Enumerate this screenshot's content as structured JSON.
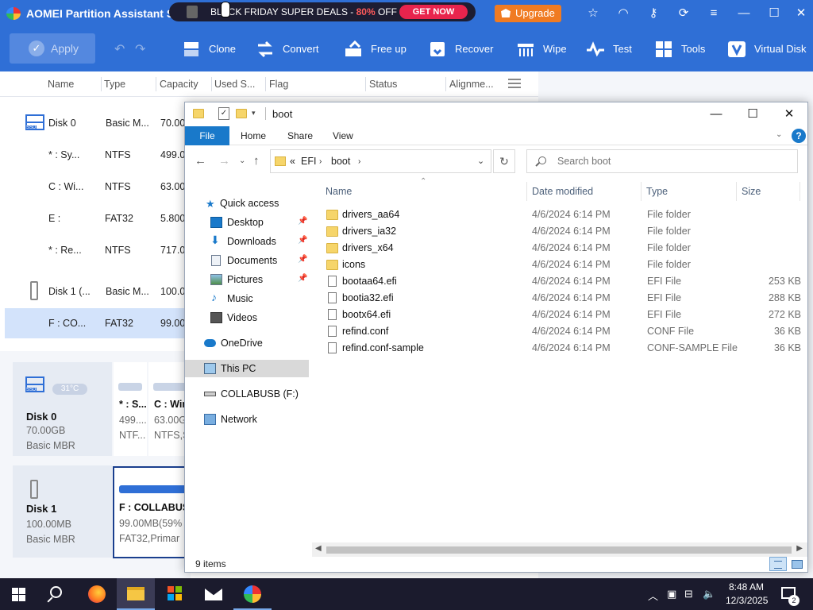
{
  "aomei": {
    "title": "AOMEI Partition Assistant S...",
    "ad": {
      "text_before": "BLACK FRIDAY SUPER DEALS - ",
      "percent": "80%",
      "text_after": " OFF",
      "button": "GET NOW"
    },
    "upgrade": "Upgrade",
    "toolbar": {
      "apply": "Apply",
      "items": [
        "Clone",
        "Convert",
        "Free up",
        "Recover",
        "Wipe",
        "Test",
        "Tools",
        "Virtual Disk"
      ]
    },
    "columns": [
      "Name",
      "Type",
      "Capacity",
      "Used S...",
      "Flag",
      "Status",
      "Alignme..."
    ],
    "rows": [
      {
        "name": "Disk 0",
        "type": "Basic M...",
        "cap": "70.00"
      },
      {
        "name": "* : Sy...",
        "type": "NTFS",
        "cap": "499.0"
      },
      {
        "name": "C : Wi...",
        "type": "NTFS",
        "cap": "63.00"
      },
      {
        "name": "E :",
        "type": "FAT32",
        "cap": "5.800"
      },
      {
        "name": "* : Re...",
        "type": "NTFS",
        "cap": "717.0"
      },
      {
        "name": "Disk 1 (...",
        "type": "Basic M...",
        "cap": "100.0"
      },
      {
        "name": "F : CO...",
        "type": "FAT32",
        "cap": "99.00"
      }
    ],
    "disk0_card": {
      "temp": "31°C",
      "name": "Disk 0",
      "size": "70.00GB",
      "type": "Basic MBR"
    },
    "disk0_parts": [
      {
        "name": "* : S...",
        "size": "499....",
        "fs": "NTF..."
      },
      {
        "name": "C : Wir",
        "size": "63.00G",
        "fs": "NTFS,S"
      }
    ],
    "disk1_card": {
      "name": "Disk 1",
      "size": "100.00MB",
      "type": "Basic MBR"
    },
    "disk1_part": {
      "name": "F : COLLABUS",
      "size": "99.00MB(59%",
      "fs": "FAT32,Primar"
    }
  },
  "explorer": {
    "title": "boot",
    "tabs": {
      "file": "File",
      "home": "Home",
      "share": "Share",
      "view": "View"
    },
    "address": {
      "prefix": "«",
      "segments": [
        "EFI",
        "boot"
      ]
    },
    "search_placeholder": "Search boot",
    "nav": [
      {
        "label": "Quick access",
        "icon": "star-icon",
        "pinned": false
      },
      {
        "label": "Desktop",
        "icon": "desktop-icon",
        "pinned": true
      },
      {
        "label": "Downloads",
        "icon": "downloads-icon",
        "pinned": true
      },
      {
        "label": "Documents",
        "icon": "documents-icon",
        "pinned": true
      },
      {
        "label": "Pictures",
        "icon": "pictures-icon",
        "pinned": true
      },
      {
        "label": "Music",
        "icon": "music-icon",
        "pinned": false
      },
      {
        "label": "Videos",
        "icon": "videos-icon",
        "pinned": false
      },
      {
        "label": "OneDrive",
        "icon": "cloud-icon",
        "pinned": false
      },
      {
        "label": "This PC",
        "icon": "pc-icon",
        "pinned": false
      },
      {
        "label": "COLLABUSB (F:)",
        "icon": "usb-drive-icon",
        "pinned": false
      },
      {
        "label": "Network",
        "icon": "network-icon",
        "pinned": false
      }
    ],
    "columns": {
      "name": "Name",
      "date": "Date modified",
      "type": "Type",
      "size": "Size"
    },
    "files": [
      {
        "name": "drivers_aa64",
        "date": "4/6/2024 6:14 PM",
        "type": "File folder",
        "size": "",
        "kind": "folder"
      },
      {
        "name": "drivers_ia32",
        "date": "4/6/2024 6:14 PM",
        "type": "File folder",
        "size": "",
        "kind": "folder"
      },
      {
        "name": "drivers_x64",
        "date": "4/6/2024 6:14 PM",
        "type": "File folder",
        "size": "",
        "kind": "folder"
      },
      {
        "name": "icons",
        "date": "4/6/2024 6:14 PM",
        "type": "File folder",
        "size": "",
        "kind": "folder"
      },
      {
        "name": "bootaa64.efi",
        "date": "4/6/2024 6:14 PM",
        "type": "EFI File",
        "size": "253 KB",
        "kind": "file"
      },
      {
        "name": "bootia32.efi",
        "date": "4/6/2024 6:14 PM",
        "type": "EFI File",
        "size": "288 KB",
        "kind": "file"
      },
      {
        "name": "bootx64.efi",
        "date": "4/6/2024 6:14 PM",
        "type": "EFI File",
        "size": "272 KB",
        "kind": "file"
      },
      {
        "name": "refind.conf",
        "date": "4/6/2024 6:14 PM",
        "type": "CONF File",
        "size": "36 KB",
        "kind": "file"
      },
      {
        "name": "refind.conf-sample",
        "date": "4/6/2024 6:14 PM",
        "type": "CONF-SAMPLE File",
        "size": "36 KB",
        "kind": "file"
      }
    ],
    "status": "9 items"
  },
  "taskbar": {
    "time": "8:48 AM",
    "date": "12/3/2025",
    "notifications": "2"
  }
}
